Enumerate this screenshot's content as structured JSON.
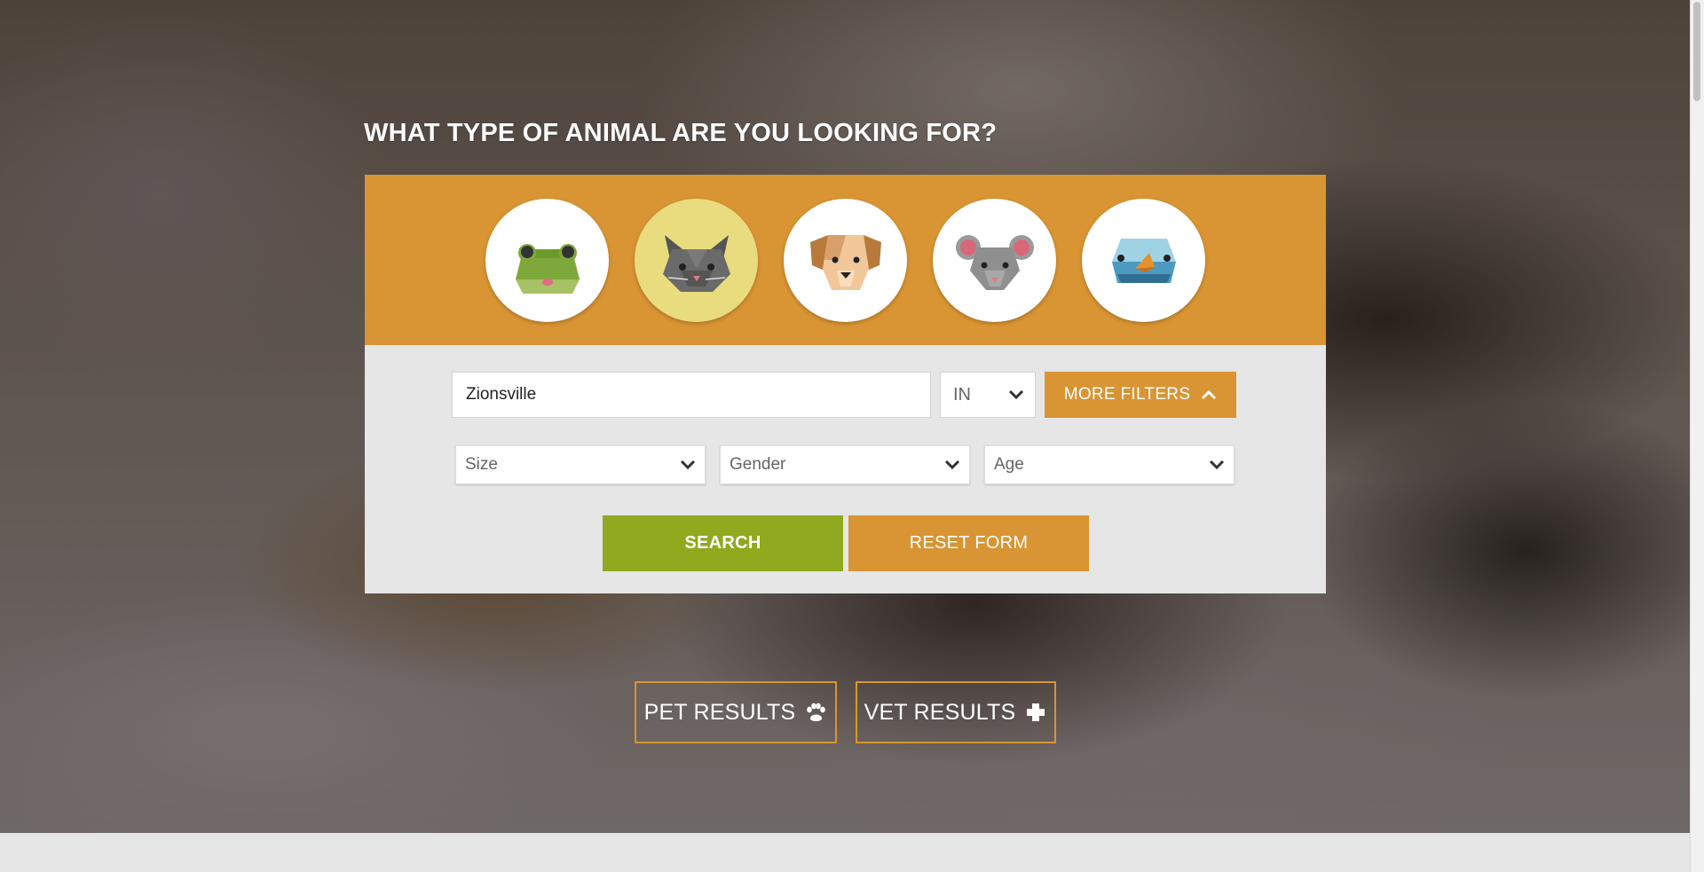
{
  "hero": {
    "title": "WHAT TYPE OF ANIMAL ARE YOU LOOKING FOR?"
  },
  "animals": [
    {
      "name": "frog-icon",
      "selected": false
    },
    {
      "name": "cat-icon",
      "selected": true
    },
    {
      "name": "dog-icon",
      "selected": false
    },
    {
      "name": "mouse-icon",
      "selected": false
    },
    {
      "name": "bird-icon",
      "selected": false
    }
  ],
  "search": {
    "location_value": "Zionsville",
    "state_value": "IN",
    "more_filters_label": "MORE FILTERS",
    "size_label": "Size",
    "gender_label": "Gender",
    "age_label": "Age",
    "search_label": "SEARCH",
    "reset_label": "RESET FORM"
  },
  "results": {
    "pet_label": "PET RESULTS",
    "vet_label": "VET RESULTS"
  },
  "colors": {
    "accent_orange": "#d99433",
    "search_green": "#90a91f",
    "selected_yellow": "#e9dc7f",
    "panel_gray": "#e6e6e6"
  }
}
